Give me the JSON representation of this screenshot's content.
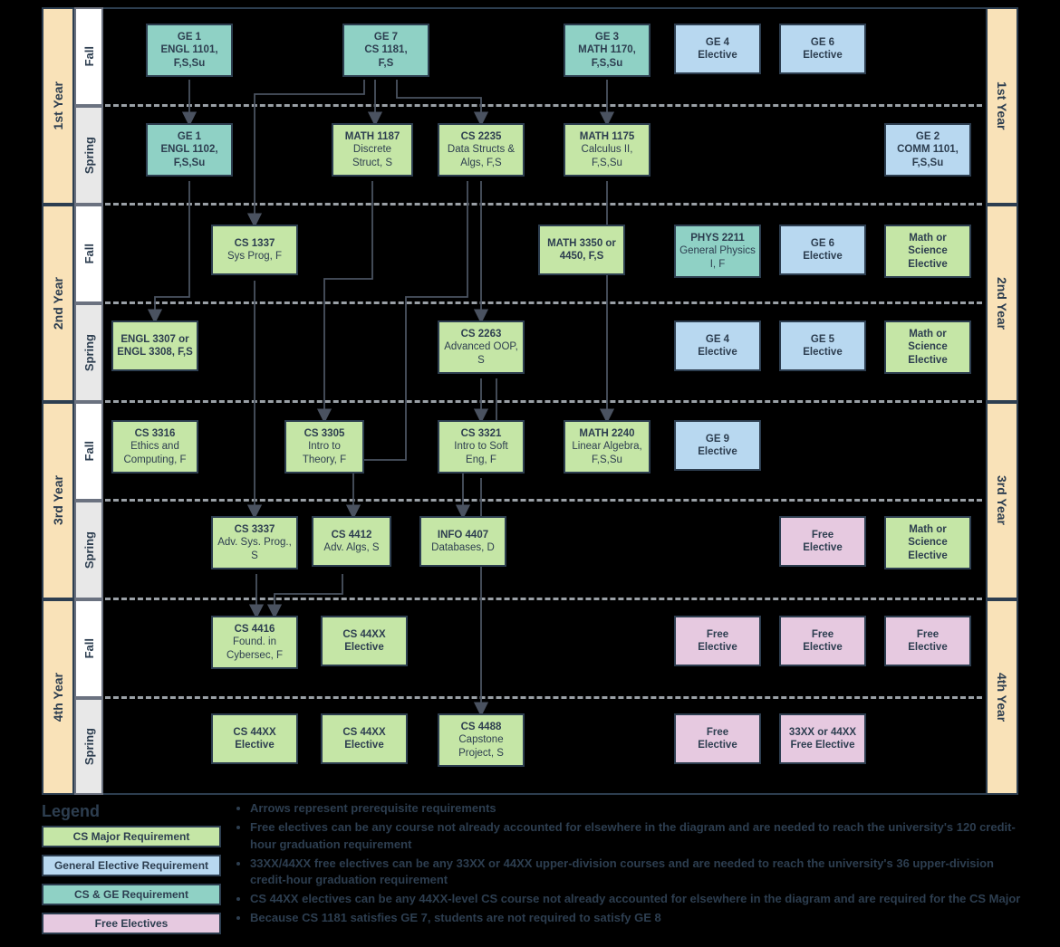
{
  "years": [
    "1st Year",
    "2nd Year",
    "3rd Year",
    "4th Year"
  ],
  "sems": {
    "fall": "Fall",
    "spring": "Spring"
  },
  "courses": {
    "y1f": {
      "engl1101": "GE 1\nENGL 1101,\nF,S,Su",
      "cs1181": "GE 7\nCS 1181,\nF,S",
      "math1170": "GE 3\nMATH 1170,\nF,S,Su",
      "ge4": "GE 4\nElective",
      "ge6": "GE 6\nElective"
    },
    "y1s": {
      "engl1102": "GE 1\nENGL 1102,\nF,S,Su",
      "math1187": "MATH 1187\nDiscrete Struct, S",
      "cs2235": "CS 2235\nData Structs & Algs, F,S",
      "math1175": "MATH 1175\nCalculus II,\nF,S,Su",
      "comm1101": "GE 2\nCOMM 1101,\nF,S,Su"
    },
    "y2f": {
      "cs1337": "CS 1337\nSys Prog, F",
      "math3350": "MATH 3350 or 4450, F,S",
      "phys2211": "PHYS 2211\nGeneral Physics I, F",
      "ge6": "GE 6\nElective",
      "msci": "Math or Science Elective"
    },
    "y2s": {
      "engl3307": "ENGL 3307 or ENGL 3308, F,S",
      "cs2263": "CS 2263\nAdvanced OOP, S",
      "ge4": "GE 4\nElective",
      "ge5": "GE 5\nElective",
      "msci": "Math or Science Elective"
    },
    "y3f": {
      "cs3316": "CS 3316\nEthics and Computing, F",
      "cs3305": "CS 3305\nIntro to Theory, F",
      "cs3321": "CS 3321\nIntro to Soft Eng, F",
      "math2240": "MATH 2240\nLinear Algebra, F,S,Su",
      "ge9": "GE 9\nElective"
    },
    "y3s": {
      "cs3337": "CS 3337\nAdv. Sys. Prog., S",
      "cs4412": "CS 4412\nAdv. Algs, S",
      "info4407": "INFO 4407\nDatabases, D",
      "free": "Free\nElective",
      "msci": "Math or Science Elective"
    },
    "y4f": {
      "cs4416": "CS 4416\nFound. in Cybersec, F",
      "cs44xx": "CS 44XX\nElective",
      "free1": "Free\nElective",
      "free2": "Free\nElective",
      "free3": "Free\nElective"
    },
    "y4s": {
      "cs44xx1": "CS 44XX\nElective",
      "cs44xx2": "CS 44XX\nElective",
      "cs4488": "CS 4488\nCapstone Project, S",
      "free": "Free\nElective",
      "upper": "33XX or 44XX Free Elective"
    }
  },
  "legend": {
    "title": "Legend",
    "chips": {
      "green": "CS Major Requirement",
      "blue": "General Elective Requirement",
      "teal": "CS & GE Requirement",
      "pink": "Free Electives"
    },
    "notes": [
      "Arrows represent prerequisite requirements",
      "Free electives can be any course not already accounted for elsewhere in the diagram and are needed to reach the university's 120 credit-hour graduation requirement",
      "33XX/44XX free electives can be any 33XX or 44XX upper-division courses and are needed to reach the university's 36 upper-division credit-hour graduation requirement",
      "CS 44XX electives can be any 44XX-level CS course not already accounted for elsewhere in the diagram and are required for the CS Major",
      "Because CS 1181 satisfies GE 7, students are not required to satisfy GE 8"
    ]
  }
}
